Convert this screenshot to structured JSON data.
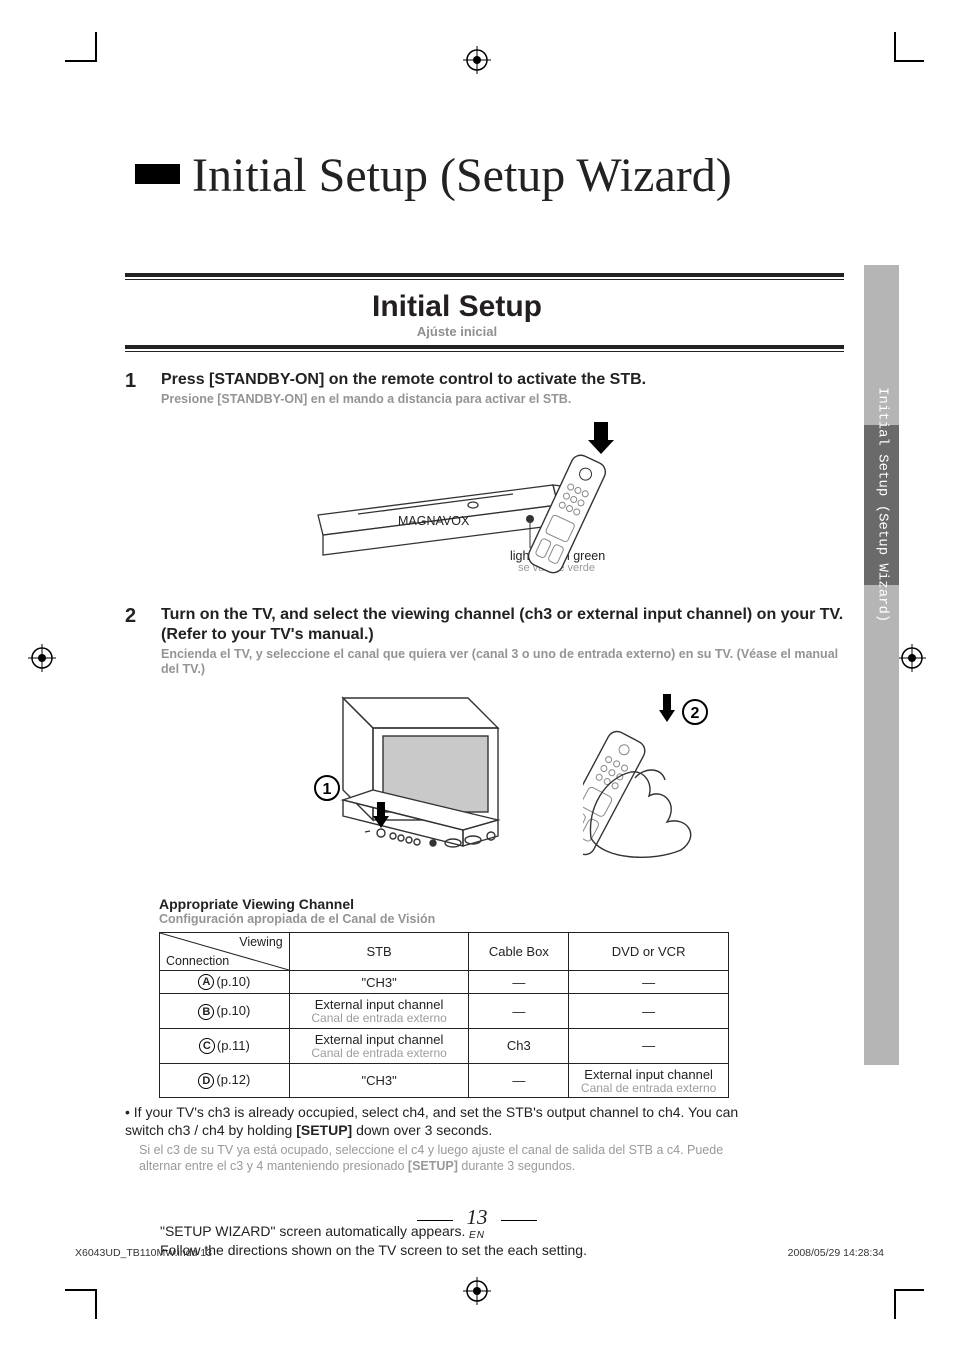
{
  "page": {
    "title": "Initial Setup (Setup Wizard)",
    "section_title": "Initial Setup",
    "section_sub": "Ajúste inicial",
    "footer_left": "X6043UD_TB110MW.indd   13",
    "footer_right": "2008/05/29   14:28:34",
    "number": "13",
    "lang": "EN",
    "side_tab_label": "Initial Setup\n(Setup Wizard)"
  },
  "steps": {
    "one": {
      "num": "1",
      "en": "Press [STANDBY-ON] on the remote control to activate the STB.",
      "es": "Presione [STANDBY-ON] en el mando a distancia para activar el STB.",
      "caption_en": "lights up in green",
      "caption_es": "se vuelve verde",
      "device_label": "MAGNAVOX"
    },
    "two": {
      "num": "2",
      "en": "Turn on the TV, and select the viewing channel (ch3 or external input channel) on your TV. (Refer to your TV's manual.)",
      "es": "Encienda el TV, y seleccione el canal que quiera ver (canal 3 o uno de entrada externo) en su TV. (Véase el manual del TV.)",
      "circ_left": "1",
      "circ_right": "2"
    }
  },
  "viewing": {
    "head_en": "Appropriate Viewing Channel",
    "head_es": "Configuración apropiada de el Canal de Visión",
    "diag_a": "Viewing",
    "diag_b": "Connection",
    "cols": {
      "stb": "STB",
      "cable": "Cable Box",
      "dvd": "DVD or VCR"
    },
    "ext_en": "External input channel",
    "ext_es": "Canal de entrada externo",
    "dash": "—",
    "rows": {
      "a": {
        "label": "A",
        "page": "(p.10)",
        "stb": "\"CH3\""
      },
      "b": {
        "label": "B",
        "page": "(p.10)"
      },
      "c": {
        "label": "C",
        "page": "(p.11)",
        "cable": "Ch3"
      },
      "d": {
        "label": "D",
        "page": "(p.12)",
        "stb": "\"CH3\""
      }
    },
    "note_en_1": "If your TV's ch3 is already occupied, select ch4, and set the STB's output channel to ch4. You can switch ch3 / ch4 by holding ",
    "note_en_2": "[SETUP]",
    "note_en_3": " down over 3 seconds.",
    "note_es_1": "Si el c3 de su TV ya está ocupado, seleccione el c4 y luego ajuste el canal de salida del STB a c4. Puede alternar entre el c3 y 4 manteniendo presionado ",
    "note_es_2": "[SETUP]",
    "note_es_3": " durante 3 segundos."
  },
  "trailer": {
    "l1": "\"SETUP WIZARD\" screen automatically appears.",
    "l2": "Follow the directions shown on the TV screen to set the each setting."
  },
  "chart_data": {
    "type": "table",
    "title": "Appropriate Viewing Channel",
    "columns": [
      "Connection",
      "STB",
      "Cable Box",
      "DVD or VCR"
    ],
    "rows": [
      {
        "Connection": "A (p.10)",
        "STB": "\"CH3\"",
        "Cable Box": "—",
        "DVD or VCR": "—"
      },
      {
        "Connection": "B (p.10)",
        "STB": "External input channel",
        "Cable Box": "—",
        "DVD or VCR": "—"
      },
      {
        "Connection": "C (p.11)",
        "STB": "External input channel",
        "Cable Box": "Ch3",
        "DVD or VCR": "—"
      },
      {
        "Connection": "D (p.12)",
        "STB": "\"CH3\"",
        "Cable Box": "—",
        "DVD or VCR": "External input channel"
      }
    ]
  }
}
